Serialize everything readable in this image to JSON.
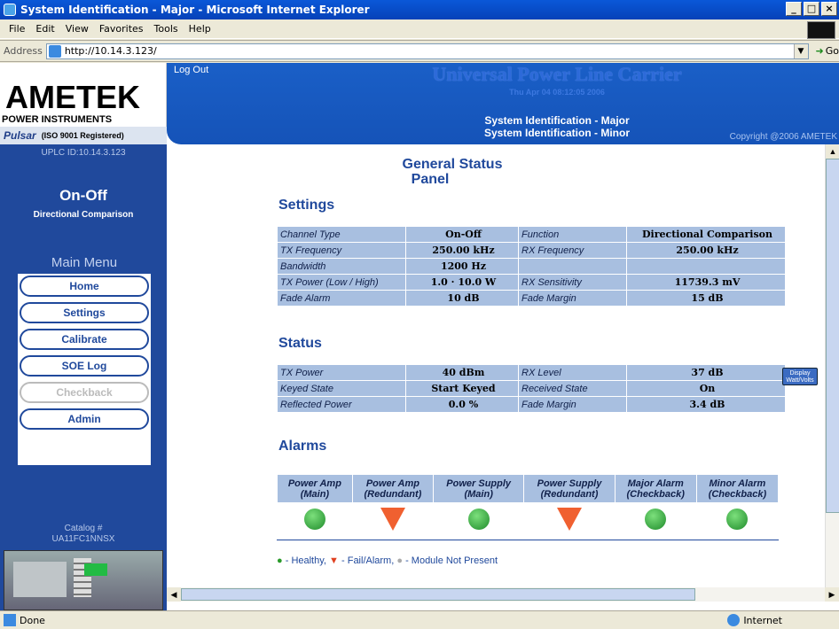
{
  "window": {
    "title": "System Identification - Major - Microsoft Internet Explorer"
  },
  "menu": [
    "File",
    "Edit",
    "View",
    "Favorites",
    "Tools",
    "Help"
  ],
  "address": {
    "label": "Address",
    "url": "http://10.14.3.123/",
    "go": "Go"
  },
  "logo": {
    "brand": "AMETEK",
    "division": "POWER INSTRUMENTS",
    "product": "Pulsar",
    "iso": "(ISO 9001 Registered)"
  },
  "banner": {
    "logout": "Log Out",
    "app_title": "Universal Power Line Carrier",
    "date": "Thu Apr 04 08:12:05 2006",
    "link_major": "System Identification - Major",
    "link_minor": "System Identification - Minor",
    "copyright": "Copyright @2006 AMETEK"
  },
  "sidebar": {
    "uplc_id": "UPLC ID:10.14.3.123",
    "mode": "On-Off",
    "scheme": "Directional Comparison",
    "menu_title": "Main Menu",
    "items": [
      {
        "label": "Home",
        "enabled": true
      },
      {
        "label": "Settings",
        "enabled": true
      },
      {
        "label": "Calibrate",
        "enabled": true
      },
      {
        "label": "SOE Log",
        "enabled": true
      },
      {
        "label": "Checkback",
        "enabled": false
      },
      {
        "label": "Admin",
        "enabled": true
      }
    ],
    "catalog_label": "Catalog #",
    "catalog_number": "UA11FC1NNSX"
  },
  "main": {
    "title": "General Status",
    "subtitle": "Panel",
    "settings": {
      "heading": "Settings",
      "rows": [
        [
          "Channel Type",
          "On-Off",
          "Function",
          "Directional Comparison"
        ],
        [
          "TX Frequency",
          "250.00 kHz",
          "RX Frequency",
          "250.00 kHz"
        ],
        [
          "Bandwidth",
          "1200 Hz",
          "",
          ""
        ],
        [
          "TX Power (Low / High)",
          "1.0 · 10.0 W",
          "RX Sensitivity",
          "11739.3 mV"
        ],
        [
          "Fade Alarm",
          "10 dB",
          "Fade Margin",
          "15 dB"
        ]
      ]
    },
    "status": {
      "heading": "Status",
      "rows": [
        [
          "TX Power",
          "40 dBm",
          "RX Level",
          "37 dB"
        ],
        [
          "Keyed State",
          "Start Keyed",
          "Received State",
          "On"
        ],
        [
          "Reflected Power",
          "0.0 %",
          "Fade Margin",
          "3.4 dB"
        ]
      ]
    },
    "display_button": "Display Watt/Volts",
    "alarms": {
      "heading": "Alarms",
      "items": [
        {
          "line1": "Power Amp",
          "line2": "(Main)",
          "state": "healthy"
        },
        {
          "line1": "Power Amp",
          "line2": "(Redundant)",
          "state": "fail"
        },
        {
          "line1": "Power Supply",
          "line2": "(Main)",
          "state": "healthy"
        },
        {
          "line1": "Power Supply",
          "line2": "(Redundant)",
          "state": "fail"
        },
        {
          "line1": "Major Alarm",
          "line2": "(Checkback)",
          "state": "healthy"
        },
        {
          "line1": "Minor Alarm",
          "line2": "(Checkback)",
          "state": "healthy"
        }
      ]
    },
    "legend": {
      "healthy": "- Healthy,",
      "fail": "- Fail/Alarm,",
      "missing": "- Module Not Present"
    }
  },
  "statusbar": {
    "text": "Done",
    "zone": "Internet"
  },
  "colors": {
    "accent": "#20499c",
    "table": "#a8bfe0",
    "healthy": "#2a9a2a",
    "fail": "#f06030"
  }
}
